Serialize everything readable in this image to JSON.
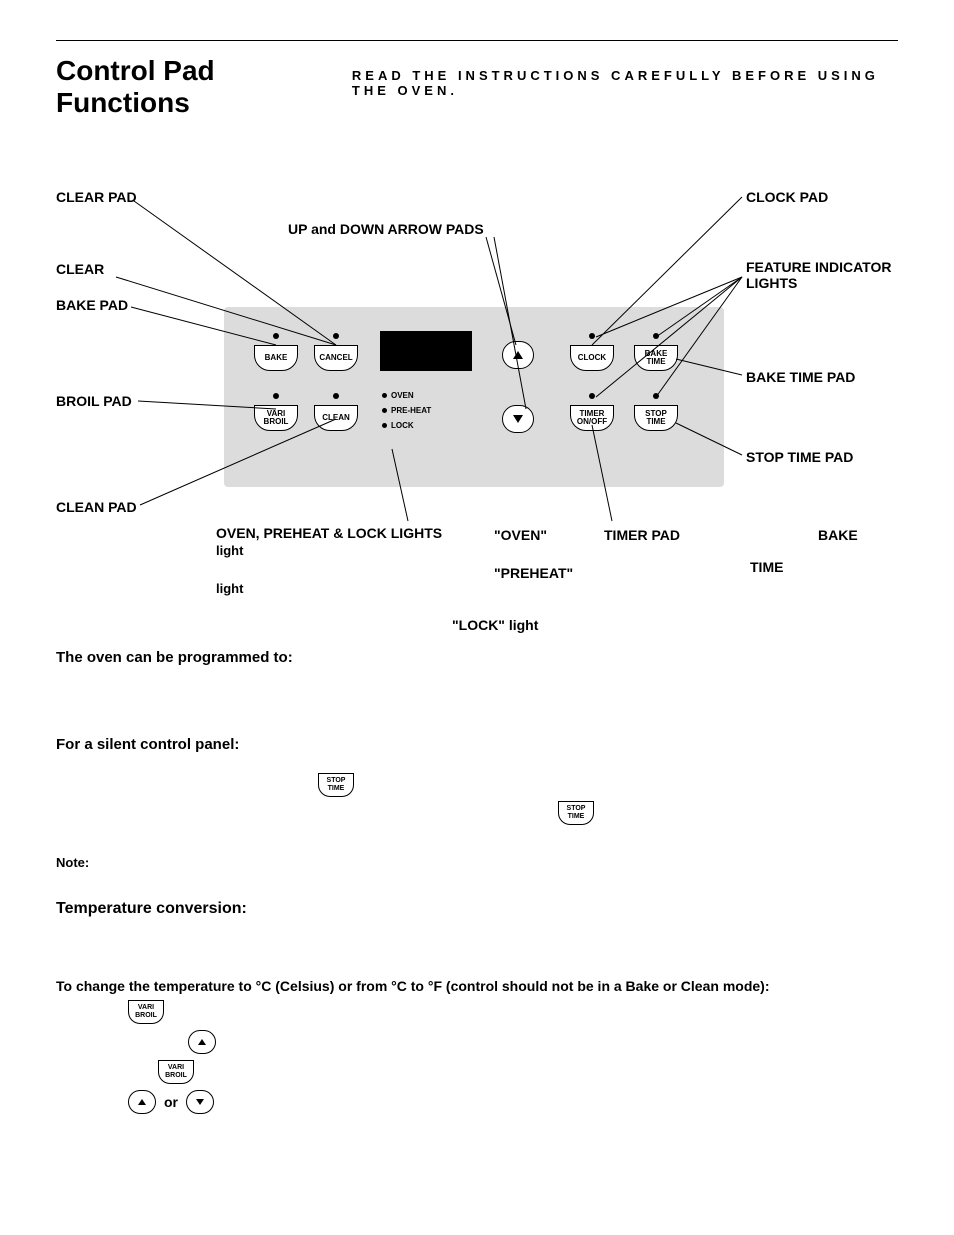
{
  "title": "Control Pad Functions",
  "subtitle": "READ THE INSTRUCTIONS CAREFULLY BEFORE USING THE OVEN.",
  "callouts": {
    "clear_pad": "CLEAR PAD",
    "up_down": "UP and DOWN ARROW PADS",
    "clock_pad": "CLOCK PAD",
    "clear": "CLEAR",
    "bake_pad": "BAKE PAD",
    "feature_lights": "FEATURE INDICATOR LIGHTS",
    "bake_time_pad": "BAKE TIME PAD",
    "broil_pad": "BROIL PAD",
    "stop_time_pad": "STOP TIME PAD",
    "clean_pad": "CLEAN PAD",
    "ophl": "OVEN, PREHEAT & LOCK LIGHTS",
    "light1": "light",
    "light2": "light",
    "oven_light": "\"OVEN\"",
    "preheat_light": "\"PREHEAT\"",
    "lock_light": "\"LOCK\" light",
    "timer_pad": "TIMER PAD",
    "bake": "BAKE",
    "time": "TIME"
  },
  "panel": {
    "row1": {
      "bake": "BAKE",
      "cancel": "CANCEL",
      "clock": "CLOCK",
      "bake_time": "BAKE\nTIME"
    },
    "row2": {
      "vari_broil": "VARI\nBROIL",
      "clean": "CLEAN",
      "timer": "TIMER\nON/OFF",
      "stop_time": "STOP\nTIME"
    },
    "status": {
      "oven": "OVEN",
      "preheat": "PRE-HEAT",
      "lock": "LOCK"
    }
  },
  "body": {
    "programmed": "The oven can be programmed to:",
    "silent": "For a silent control panel:",
    "note": "Note:",
    "temp_title": "Temperature conversion:",
    "temp_instr": "To change the temperature to °C (Celsius) or from °C to °F (control should not be in a Bake or Clean mode):",
    "or": "or"
  },
  "inline_pads": {
    "stop_time": "STOP\nTIME",
    "vari_broil": "VARI\nBROIL"
  }
}
